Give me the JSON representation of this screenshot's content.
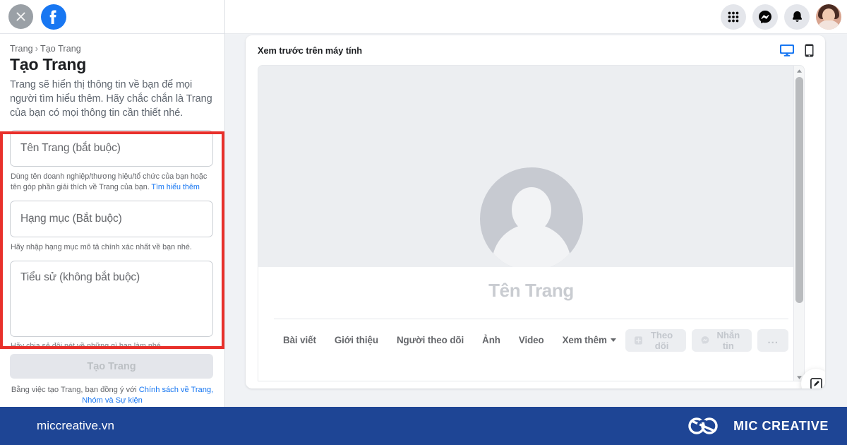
{
  "sidebar": {
    "close_icon": "close-x-icon",
    "logo_icon": "facebook-logo-icon",
    "breadcrumb": {
      "parent": "Trang",
      "separator": "›",
      "current": "Tạo Trang"
    },
    "title": "Tạo Trang",
    "description": "Trang sẽ hiển thị thông tin về bạn để mọi người tìm hiểu thêm. Hãy chắc chắn là Trang của bạn có mọi thông tin cần thiết nhé.",
    "fields": [
      {
        "name": "page_name",
        "placeholder": "Tên Trang (bắt buộc)",
        "hint": "Dùng tên doanh nghiệp/thương hiệu/tổ chức của bạn hoặc tên góp phần giải thích về Trang của bạn.",
        "hint_link": "Tìm hiểu thêm"
      },
      {
        "name": "category",
        "placeholder": "Hạng mục (Bắt buộc)",
        "hint": "Hãy nhập hạng mục mô tả chính xác nhất về bạn nhé.",
        "hint_link": ""
      },
      {
        "name": "bio",
        "placeholder": "Tiểu sử (không bắt buộc)",
        "hint": "Hãy chia sẻ đôi nét về những gì bạn làm nhé.",
        "hint_link": ""
      }
    ],
    "submit_label": "Tạo Trang",
    "tos_prefix": "Bằng việc tạo Trang, bạn đồng ý với ",
    "tos_link": "Chính sách về Trang, Nhóm và Sự kiện"
  },
  "topbar": {
    "icons": [
      {
        "name": "apps-grid-icon",
        "label": "Menu"
      },
      {
        "name": "messenger-icon",
        "label": "Messenger"
      },
      {
        "name": "notifications-bell-icon",
        "label": "Thông báo"
      }
    ],
    "avatar_name": "user-avatar"
  },
  "preview": {
    "title": "Xem trước trên máy tính",
    "devices": [
      {
        "name": "desktop-preview-icon",
        "label": "Máy tính",
        "active": true
      },
      {
        "name": "mobile-preview-icon",
        "label": "Điện thoại",
        "active": false
      }
    ],
    "page_name_placeholder": "Tên Trang",
    "tabs": [
      {
        "label": "Bài viết",
        "has_caret": false
      },
      {
        "label": "Giới thiệu",
        "has_caret": false
      },
      {
        "label": "Người theo dõi",
        "has_caret": false
      },
      {
        "label": "Ảnh",
        "has_caret": false
      },
      {
        "label": "Video",
        "has_caret": false
      },
      {
        "label": "Xem thêm",
        "has_caret": true
      }
    ],
    "actions": [
      {
        "label": "Theo dõi",
        "icon": "follow-plus-icon"
      },
      {
        "label": "Nhắn tin",
        "icon": "messenger-icon"
      },
      {
        "label": "...",
        "icon": "more-options-icon"
      }
    ]
  },
  "branding": {
    "url": "miccreative.vn",
    "name": "MIC CREATIVE",
    "logo_icon": "infinity-loop-icon",
    "bar_color": "#1e4595"
  },
  "colors": {
    "facebook_blue": "#1877f2",
    "annotation_red": "#e8302b",
    "brand_blue": "#1e4595",
    "text_primary": "#1c1e21",
    "text_secondary": "#65676b"
  }
}
